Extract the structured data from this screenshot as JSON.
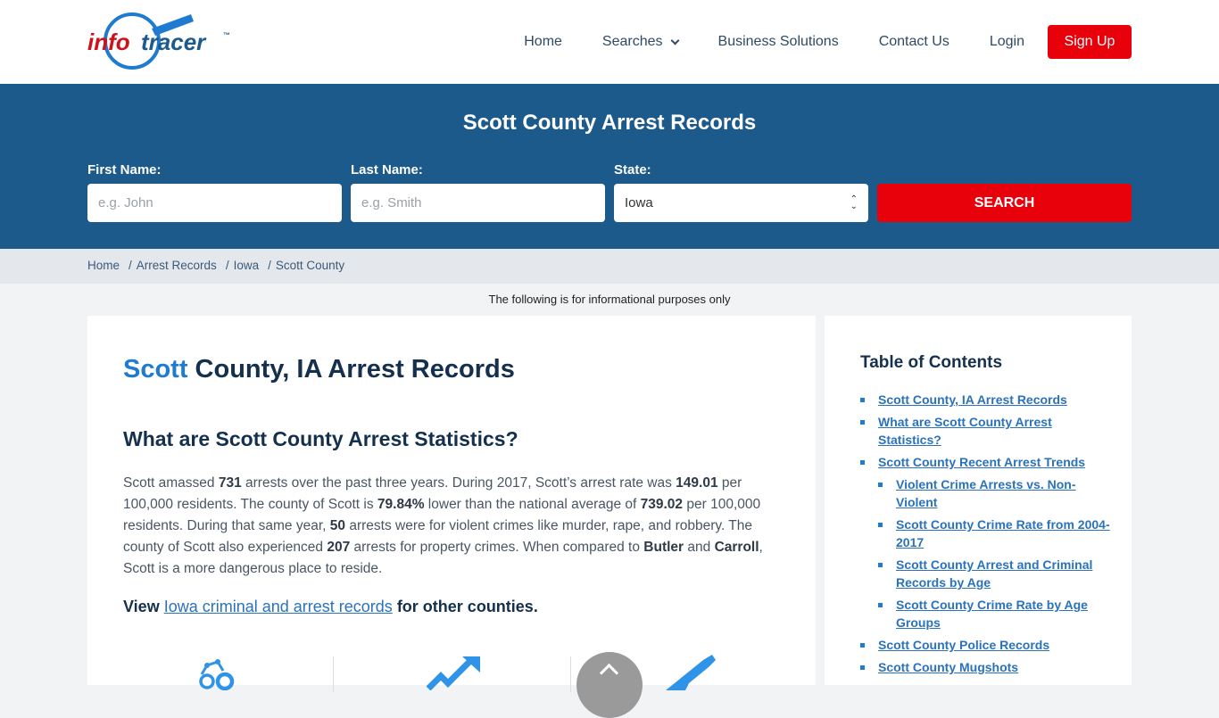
{
  "header": {
    "logo": {
      "part1": "info",
      "part2": "tracer",
      "tm": "™"
    },
    "nav": [
      {
        "label": "Home"
      },
      {
        "label": "Searches",
        "has_dropdown": true
      },
      {
        "label": "Business Solutions"
      },
      {
        "label": "Contact Us"
      },
      {
        "label": "Login"
      }
    ],
    "signup_label": "Sign Up"
  },
  "search": {
    "title": "Scott County Arrest Records",
    "first_name": {
      "label": "First Name:",
      "placeholder": "e.g. John",
      "value": ""
    },
    "last_name": {
      "label": "Last Name:",
      "placeholder": "e.g. Smith",
      "value": ""
    },
    "state": {
      "label": "State:",
      "selected": "Iowa"
    },
    "button_label": "SEARCH"
  },
  "breadcrumb": [
    "Home",
    "Arrest Records",
    "Iowa",
    "Scott County"
  ],
  "breadcrumb_sep": "/",
  "notice": "The following is for informational purposes only",
  "main": {
    "title_accent": "Scott",
    "title_rest": " County, IA Arrest Records",
    "subtitle": "What are Scott County Arrest Statistics?",
    "paragraph": {
      "t1": "Scott amassed ",
      "b1": "731",
      "t2": " arrests over the past three years. During 2017, Scott’s arrest rate was ",
      "b2": "149.01",
      "t3": " per 100,000 residents. The county of Scott is ",
      "b3": "79.84%",
      "t4": " lower than the national average of ",
      "b4": "739.02",
      "t5": " per 100,000 residents. During that same year, ",
      "b5": "50",
      "t6": " arrests were for violent crimes like murder, rape, and robbery. The county of Scott also experienced ",
      "b6": "207",
      "t7": " arrests for property crimes. When compared to ",
      "b7": "Butler",
      "t8": " and ",
      "b8": "Carroll",
      "t9": ", Scott is a more dangerous place to reside."
    },
    "view_prefix": "View ",
    "view_link": "Iowa criminal and arrest records",
    "view_suffix": " for other counties.",
    "stat_icons": [
      "handcuffs-icon",
      "trend-up-icon",
      "gun-icon"
    ],
    "accent_color": "#1e7bd0"
  },
  "toc": {
    "title": "Table of Contents",
    "items": [
      {
        "label": "Scott County, IA Arrest Records",
        "level": 1
      },
      {
        "label": "What are Scott County Arrest Statistics?",
        "level": 1
      },
      {
        "label": "Scott County Recent Arrest Trends",
        "level": 1
      },
      {
        "label": "Violent Crime Arrests vs. Non-Violent",
        "level": 2
      },
      {
        "label": "Scott County Crime Rate from 2004-2017",
        "level": 2
      },
      {
        "label": "Scott County Arrest and Criminal Records by Age",
        "level": 2
      },
      {
        "label": "Scott County Crime Rate by Age Groups",
        "level": 2
      },
      {
        "label": "Scott County Police Records",
        "level": 1
      },
      {
        "label": "Scott County Mugshots",
        "level": 1
      }
    ]
  },
  "colors": {
    "brand_blue": "#1d5a8c",
    "brand_red": "#e8000b",
    "link_blue": "#2a72bb"
  }
}
